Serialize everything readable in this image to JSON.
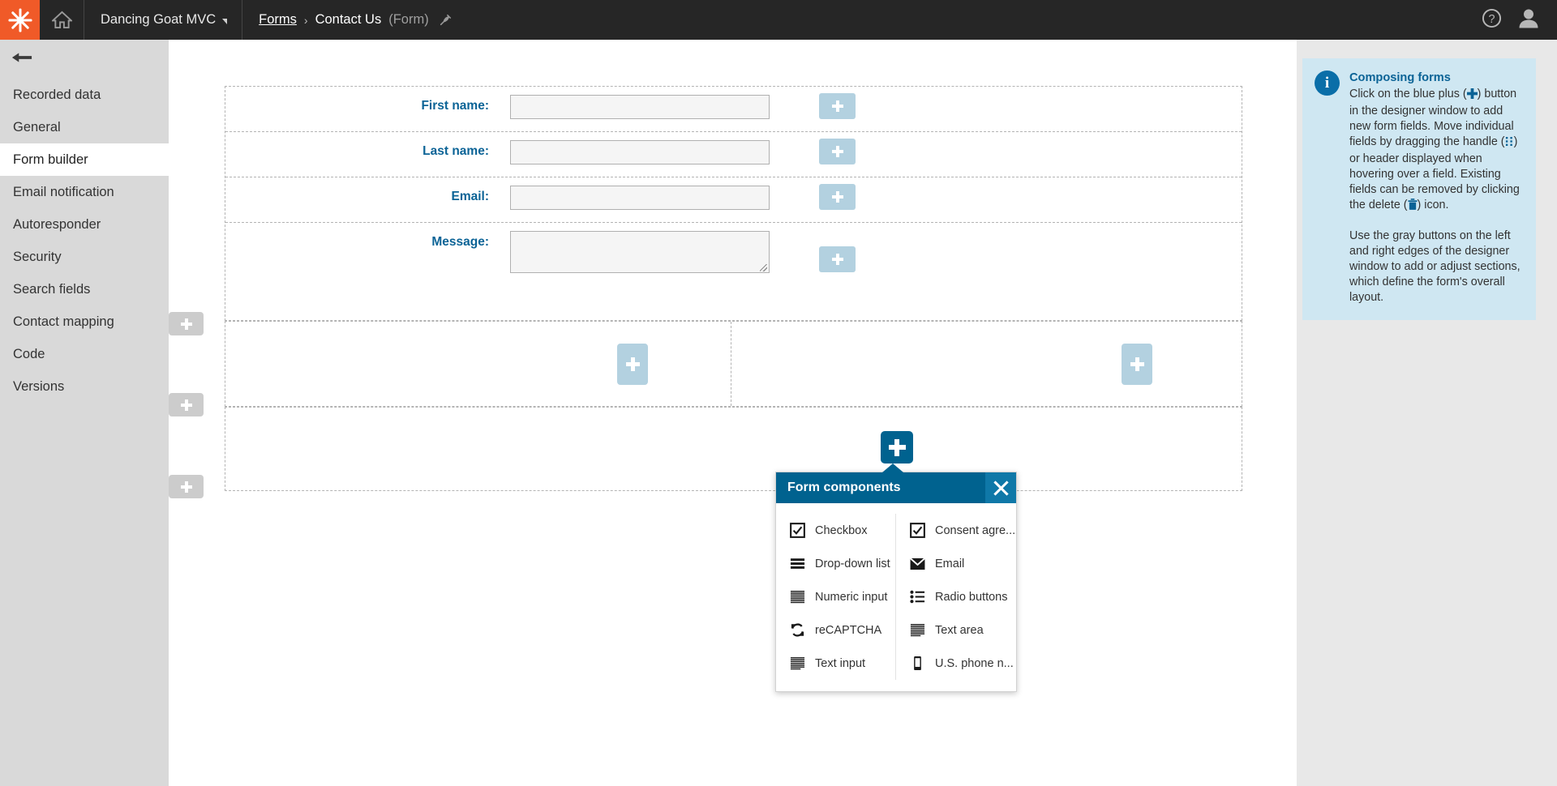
{
  "topbar": {
    "logo_icon": "kentico-asterisk-logo",
    "home_icon": "home-icon",
    "site_name": "Dancing Goat MVC",
    "site_caret_icon": "caret-down-icon",
    "breadcrumb": {
      "root": "Forms",
      "separator": "›",
      "current": "Contact Us",
      "type": "(Form)",
      "pin_icon": "pin-icon"
    },
    "help_icon": "question-mark-circle-icon",
    "user_icon": "user-avatar-icon",
    "accent_orange": "#f05a28",
    "bar_background": "#262626"
  },
  "sidebar": {
    "back_icon": "back-arrow-icon",
    "background": "#d9d9d9",
    "items": [
      {
        "label": "Recorded data",
        "active": false
      },
      {
        "label": "General",
        "active": false
      },
      {
        "label": "Form builder",
        "active": true
      },
      {
        "label": "Email notification",
        "active": false
      },
      {
        "label": "Autoresponder",
        "active": false
      },
      {
        "label": "Security",
        "active": false
      },
      {
        "label": "Search fields",
        "active": false
      },
      {
        "label": "Contact mapping",
        "active": false
      },
      {
        "label": "Code",
        "active": false
      },
      {
        "label": "Versions",
        "active": false
      }
    ]
  },
  "designer": {
    "label_color": "#0b6396",
    "fields": [
      {
        "label": "First name:",
        "value": "",
        "type": "text"
      },
      {
        "label": "Last name:",
        "value": "",
        "type": "text"
      },
      {
        "label": "Email:",
        "value": "",
        "type": "text"
      },
      {
        "label": "Message:",
        "value": "",
        "type": "textarea"
      }
    ],
    "add_field_icon": "plus-icon",
    "add_section_icon": "plus-icon",
    "active_add_icon": "plus-icon",
    "inline_plus_color": "#b3d1e0",
    "gray_plus_color": "#cccccc",
    "active_plus_color": "#00628f"
  },
  "popup": {
    "title": "Form components",
    "close_icon": "close-x-icon",
    "header_color": "#00628f",
    "columns": [
      {
        "items": [
          {
            "label": "Checkbox",
            "icon": "checkbox-icon"
          },
          {
            "label": "Drop-down list",
            "icon": "dropdown-list-icon"
          },
          {
            "label": "Numeric input",
            "icon": "numeric-input-icon"
          },
          {
            "label": "reCAPTCHA",
            "icon": "recaptcha-icon"
          },
          {
            "label": "Text input",
            "icon": "text-input-icon"
          }
        ]
      },
      {
        "items": [
          {
            "label": "Consent agre...",
            "icon": "checkbox-icon"
          },
          {
            "label": "Email",
            "icon": "envelope-icon"
          },
          {
            "label": "Radio buttons",
            "icon": "radio-buttons-icon"
          },
          {
            "label": "Text area",
            "icon": "text-area-icon"
          },
          {
            "label": "U.S. phone n...",
            "icon": "mobile-phone-icon"
          }
        ]
      }
    ]
  },
  "help": {
    "info_icon": "info-circle-icon",
    "glyph": "i",
    "title": "Composing forms",
    "paragraph1_a": "Click on the blue plus (",
    "paragraph1_b": ") button in the designer window to add new form fields. Move individual fields by dragging the handle (",
    "paragraph1_c": ") or header displayed when hovering over a field. Existing fields can be removed by clicking the delete (",
    "paragraph1_d": ") icon.",
    "paragraph2": "Use the gray buttons on the left and right edges of the designer window to add or adjust sections, which define the form's overall layout.",
    "background": "#cfe7f2",
    "title_color": "#0b6396"
  }
}
